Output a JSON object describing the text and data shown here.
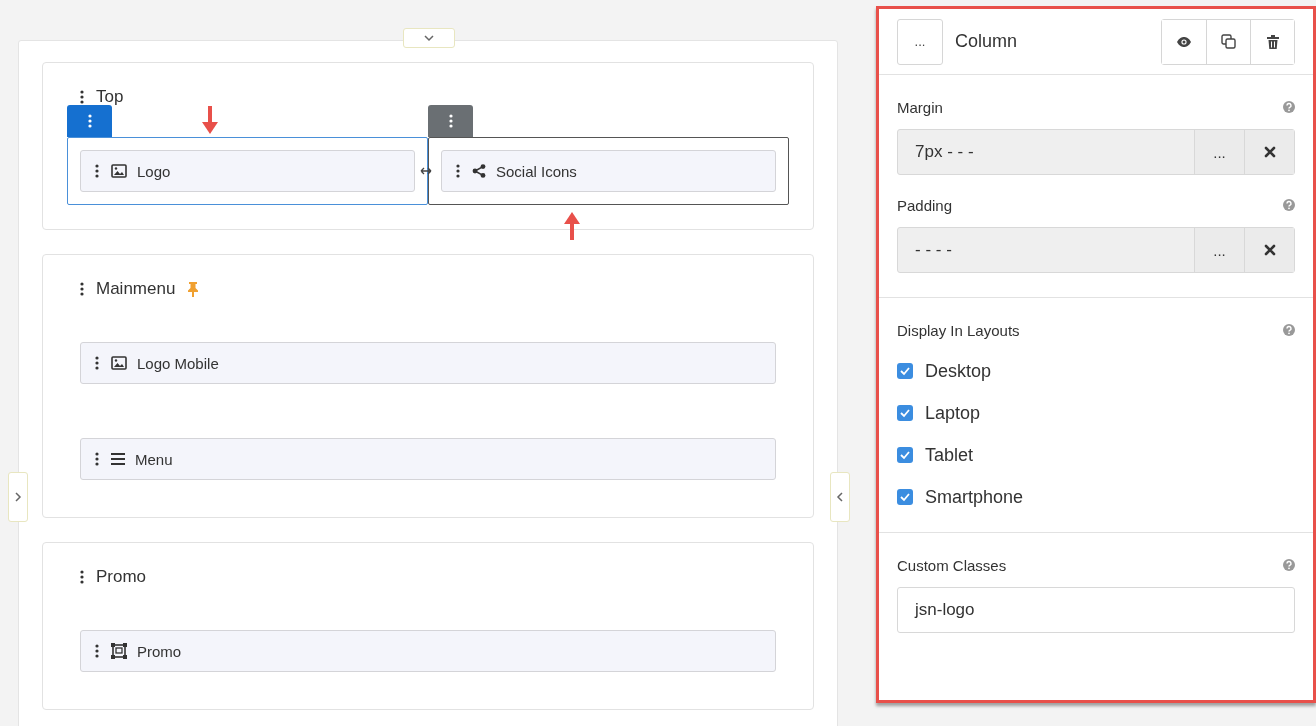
{
  "canvas": {
    "rows": [
      {
        "title": "Top",
        "pinned": false,
        "lines": [
          {
            "columns": [
              {
                "selected": true,
                "hovered": false,
                "blocks": [
                  {
                    "kind": "image",
                    "label": "Logo"
                  }
                ]
              },
              {
                "selected": false,
                "hovered": true,
                "blocks": [
                  {
                    "kind": "share",
                    "label": "Social Icons"
                  }
                ]
              }
            ]
          }
        ]
      },
      {
        "title": "Mainmenu",
        "pinned": true,
        "lines": [
          {
            "columns": [
              {
                "selected": false,
                "hovered": false,
                "blocks": [
                  {
                    "kind": "image",
                    "label": "Logo Mobile"
                  }
                ]
              }
            ]
          },
          {
            "columns": [
              {
                "selected": false,
                "hovered": false,
                "blocks": [
                  {
                    "kind": "menu",
                    "label": "Menu"
                  }
                ]
              }
            ]
          }
        ]
      },
      {
        "title": "Promo",
        "pinned": false,
        "lines": [
          {
            "columns": [
              {
                "selected": false,
                "hovered": false,
                "blocks": [
                  {
                    "kind": "promo",
                    "label": "Promo"
                  }
                ]
              }
            ]
          }
        ]
      }
    ]
  },
  "panel": {
    "more": "...",
    "title": "Column",
    "sections": [
      {
        "kind": "spacing",
        "fields": [
          {
            "label": "Margin",
            "value": "7px - - -",
            "more": "..."
          },
          {
            "label": "Padding",
            "value": "- - - -",
            "more": "..."
          }
        ]
      },
      {
        "kind": "checklist",
        "label": "Display In Layouts",
        "items": [
          {
            "label": "Desktop",
            "checked": true
          },
          {
            "label": "Laptop",
            "checked": true
          },
          {
            "label": "Tablet",
            "checked": true
          },
          {
            "label": "Smartphone",
            "checked": true
          }
        ]
      },
      {
        "kind": "text",
        "label": "Custom Classes",
        "value": "jsn-logo"
      }
    ]
  }
}
